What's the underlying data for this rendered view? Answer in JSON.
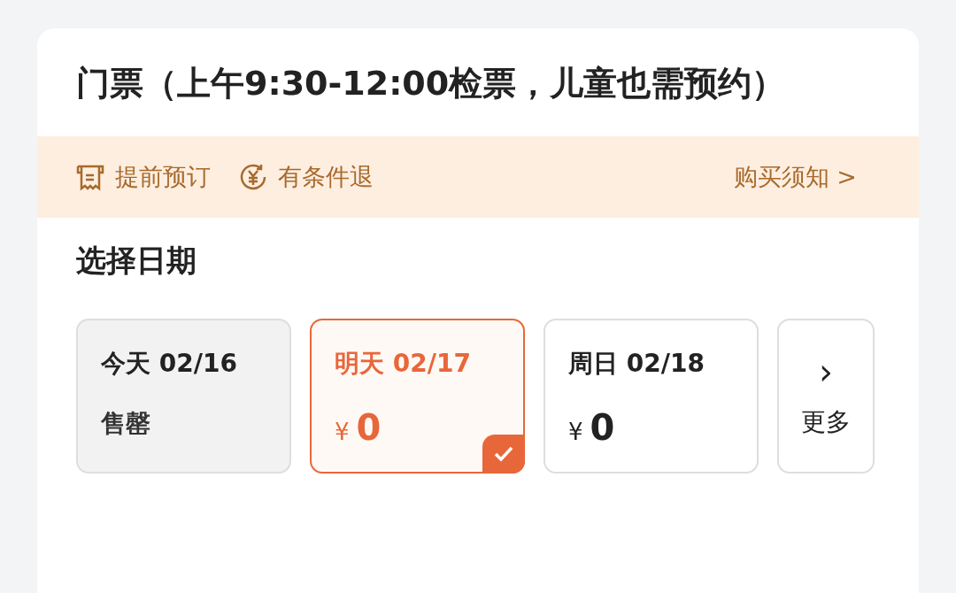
{
  "title": "门票（上午9:30-12:00检票，儿童也需预约）",
  "notice": {
    "items": [
      {
        "kind": "receipt",
        "label": "提前预订"
      },
      {
        "kind": "refund",
        "label": "有条件退"
      }
    ],
    "link": "购买须知 >"
  },
  "date_section": {
    "heading": "选择日期",
    "dates": [
      {
        "kind": "date",
        "label": "今天 02/16",
        "status": "售罄",
        "disabled": true,
        "selected": false
      },
      {
        "kind": "date",
        "label": "明天 02/17",
        "currency": "¥",
        "price": "0",
        "disabled": false,
        "selected": true
      },
      {
        "kind": "date",
        "label": "周日 02/18",
        "currency": "¥",
        "price": "0",
        "disabled": false,
        "selected": false
      },
      {
        "kind": "more",
        "arrow": "›",
        "label": "更多"
      }
    ]
  }
}
